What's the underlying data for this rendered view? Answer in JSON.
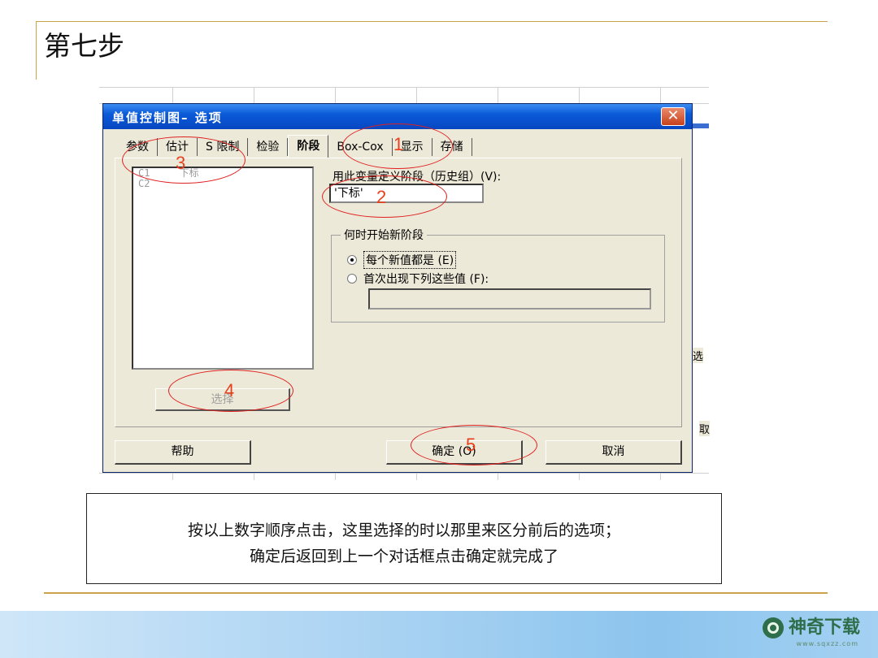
{
  "slide": {
    "title": "第七步",
    "caption_line1": "按以上数字顺序点击，这里选择的时以那里来区分前后的选项；",
    "caption_line2": "确定后返回到上一个对话框点击确定就完成了"
  },
  "background_sheet": {
    "fragment_select": "选",
    "fragment_take": "取"
  },
  "dialog": {
    "title": "单值控制图– 选项",
    "close_glyph": "✕",
    "tabs": [
      "参数",
      "估计",
      "S 限制",
      "检验",
      "阶段",
      "Box-Cox",
      "显示",
      "存储"
    ],
    "active_tab": "阶段",
    "variables": [
      {
        "col": "C1",
        "name": "下标"
      },
      {
        "col": "C2",
        "name": ""
      }
    ],
    "select_button": "选择",
    "define_stages_label": "用此变量定义阶段（历史组）(V):",
    "define_stages_value": "'下标'",
    "new_stage_group": "何时开始新阶段",
    "option_each_new_value": "每个新值都是 (E)",
    "option_first_occurrence": "首次出现下列这些值 (F):",
    "first_occurrence_values": "",
    "help_button": "帮助",
    "ok_button": "确定 (O)",
    "cancel_button": "取消"
  },
  "annotations": [
    "1",
    "2",
    "3",
    "4",
    "5"
  ],
  "colors": {
    "annotation": "#e02020",
    "titlebar": "#0a5ad8",
    "accent_rule": "#c9a24a",
    "footer": "#8cc4ee",
    "logo": "#2f6e4a"
  },
  "logo": {
    "text": "神奇下载",
    "url": "www.sqxzz.com",
    "icon": "sq-logo-icon"
  }
}
